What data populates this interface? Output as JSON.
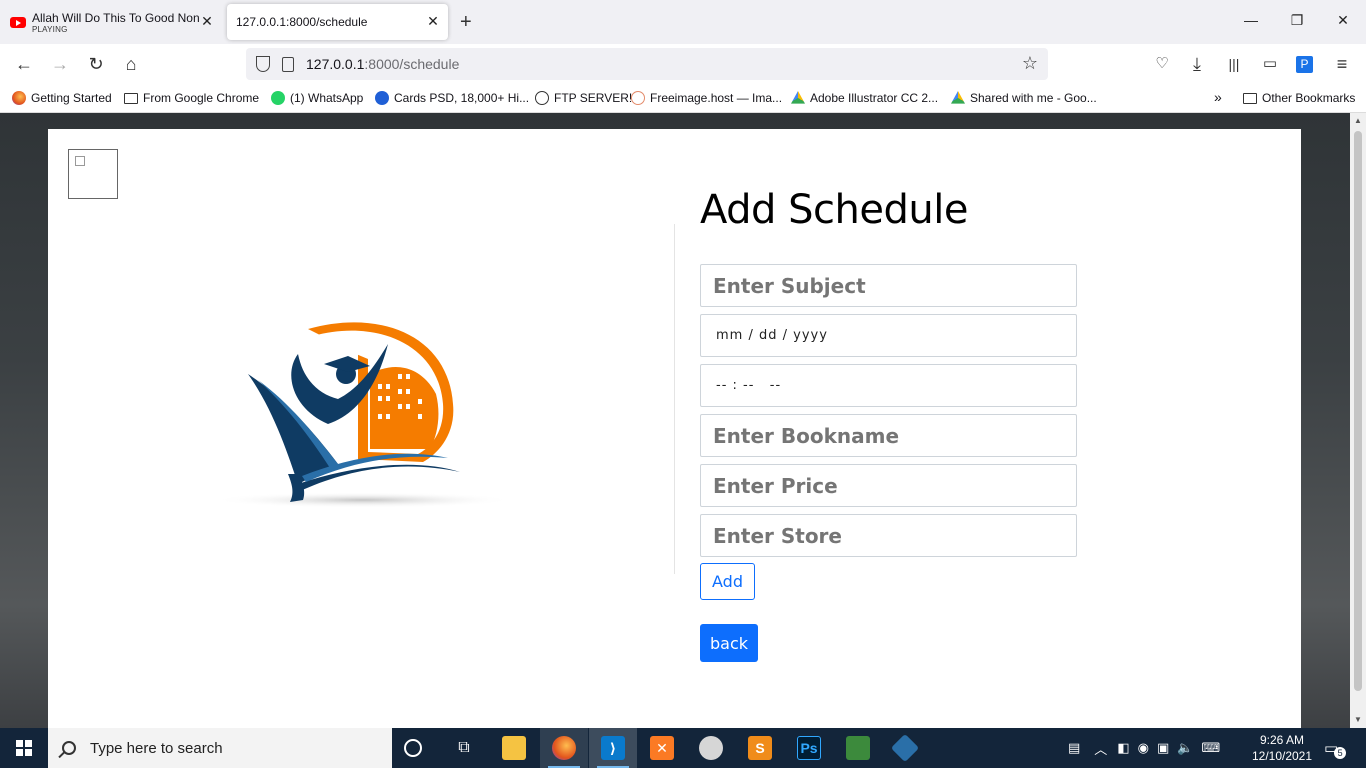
{
  "browser": {
    "tabs": [
      {
        "title": "Allah Will Do This To Good Non",
        "subtitle": "PLAYING",
        "active": false
      },
      {
        "title": "127.0.0.1:8000/schedule",
        "subtitle": "",
        "active": true
      }
    ],
    "url_host": "127.0.0.1",
    "url_rest": ":8000/schedule"
  },
  "bookmarks": {
    "items": [
      {
        "label": "Getting Started",
        "icon": "firefox-icon"
      },
      {
        "label": "From Google Chrome",
        "icon": "folder-icon"
      },
      {
        "label": "(1) WhatsApp",
        "icon": "whatsapp-icon"
      },
      {
        "label": "Cards PSD, 18,000+ Hi...",
        "icon": "freepik-icon"
      },
      {
        "label": "FTP SERVER!",
        "icon": "globe-icon"
      },
      {
        "label": "Freeimage.host — Ima...",
        "icon": "freeimage-icon"
      },
      {
        "label": "Adobe Illustrator CC 2...",
        "icon": "google-drive-icon"
      },
      {
        "label": "Shared with me - Goo...",
        "icon": "google-drive-icon"
      }
    ],
    "overflow": "»",
    "other": "Other Bookmarks"
  },
  "form": {
    "title": "Add Schedule",
    "subject_placeholder": "Enter Subject",
    "date_placeholder": "mm / dd / yyyy",
    "time_placeholder": "-- : --   --",
    "bookname_placeholder": "Enter Bookname",
    "price_placeholder": "Enter Price",
    "store_placeholder": "Enter Store",
    "add_label": "Add",
    "back_label": "back"
  },
  "taskbar": {
    "search_placeholder": "Type here to search",
    "time": "9:26 AM",
    "date": "12/10/2021",
    "notification_count": "5"
  },
  "colors": {
    "primary": "#0d6efd",
    "logo_navy": "#0f3b63",
    "logo_orange": "#f57c00",
    "taskbar": "#13253a"
  }
}
